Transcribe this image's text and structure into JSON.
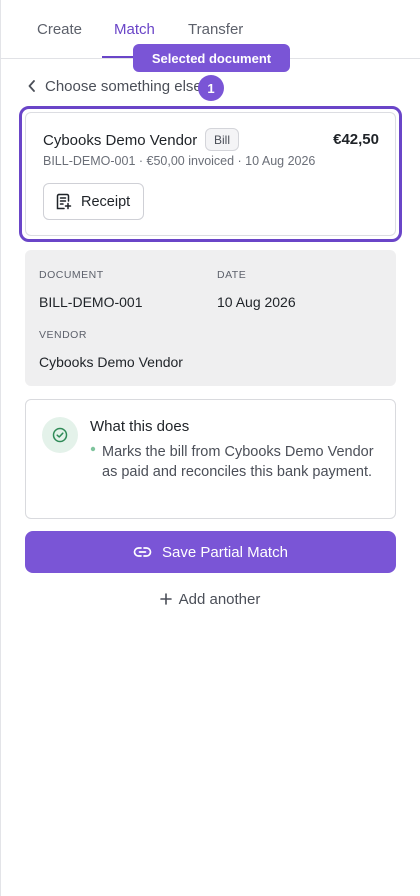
{
  "tabs": [
    {
      "label": "Create",
      "active": false
    },
    {
      "label": "Match",
      "active": true
    },
    {
      "label": "Transfer",
      "active": false
    }
  ],
  "back_link": {
    "label": "Choose something else",
    "icon": "chevron-left-icon"
  },
  "tooltip": {
    "label": "Selected document",
    "step": "1"
  },
  "document_card": {
    "vendor": "Cybooks Demo Vendor",
    "type_badge": "Bill",
    "amount": "€42,50",
    "meta": "BILL-DEMO-001 · €50,00 invoiced · 10 Aug 2026",
    "receipt_button": "Receipt"
  },
  "details": {
    "document_label": "DOCUMENT",
    "document_value": "BILL-DEMO-001",
    "date_label": "DATE",
    "date_value": "10 Aug 2026",
    "vendor_label": "VENDOR",
    "vendor_value": "Cybooks Demo Vendor"
  },
  "info": {
    "title": "What this does",
    "text": "Marks the bill from Cybooks Demo Vendor as paid and reconciles this bank payment."
  },
  "actions": {
    "save_label": "Save Partial Match",
    "add_label": "Add another"
  },
  "colors": {
    "accent": "#6a45c8",
    "accent_button": "#7a55d6",
    "success": "#2f8a57"
  }
}
